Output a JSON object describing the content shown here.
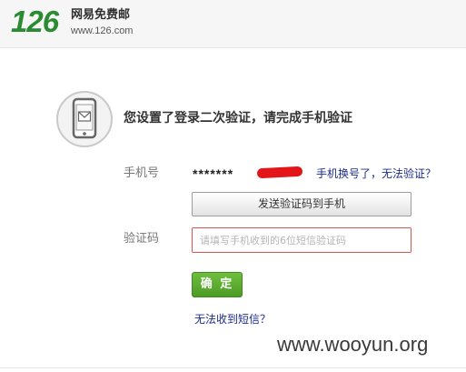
{
  "header": {
    "logo_number": "126",
    "logo_name": "网易免费邮",
    "logo_domain": "www.126.com"
  },
  "verify": {
    "icon": "phone-mail-icon",
    "title": "您设置了登录二次验证，请完成手机验证",
    "phone_label": "手机号",
    "phone_number": "*******",
    "change_link": "手机换号了，无法验证？",
    "send_button": "发送验证码到手机",
    "code_label": "验证码",
    "code_placeholder": "请填写手机收到的6位短信验证码",
    "code_value": "",
    "confirm_button": "确 定",
    "no_sms_link": "无法收到短信？"
  },
  "watermark": "www.wooyun.org",
  "colors": {
    "brand_green": "#2a8b30",
    "confirm_green": "#5aad2f",
    "link_blue": "#1a2c8c",
    "input_error_border": "#d9534f",
    "redaction_red": "#e3151a"
  }
}
